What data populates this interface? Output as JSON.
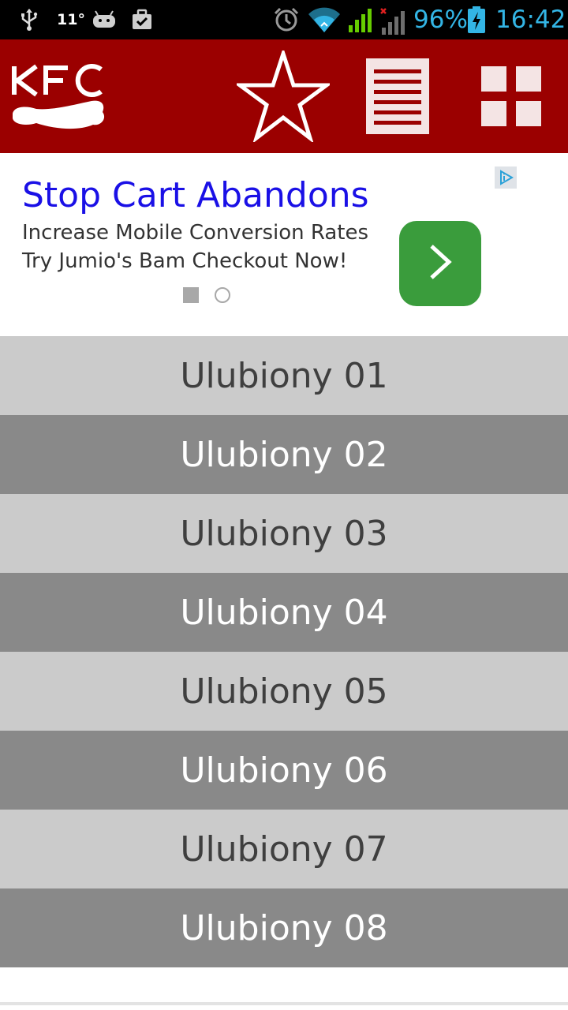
{
  "status_bar": {
    "temperature": "11°",
    "battery_percent": "96%",
    "time": "16:42",
    "accent_color": "#33b5e5",
    "icons": [
      "usb-icon",
      "android-icon",
      "briefcase-icon",
      "alarm-icon",
      "wifi-icon",
      "signal-icon",
      "signal-no-service-icon",
      "battery-charging-icon"
    ]
  },
  "app_bar": {
    "logo_text": "KFC",
    "background_color": "#9b0000",
    "actions": [
      "star-icon",
      "list-icon",
      "grid-icon"
    ]
  },
  "ad": {
    "title": "Stop Cart Abandons",
    "line1": "Increase Mobile Conversion Rates",
    "line2": "Try Jumio's Bam Checkout Now!",
    "button_icon": "chevron-right-icon",
    "choice_icon": "adchoices-icon",
    "pager": {
      "count": 2,
      "active": 1
    }
  },
  "favorites": {
    "items": [
      {
        "label": "Ulubiony 01"
      },
      {
        "label": "Ulubiony 02"
      },
      {
        "label": "Ulubiony 03"
      },
      {
        "label": "Ulubiony 04"
      },
      {
        "label": "Ulubiony 05"
      },
      {
        "label": "Ulubiony 06"
      },
      {
        "label": "Ulubiony 07"
      },
      {
        "label": "Ulubiony 08"
      }
    ]
  }
}
